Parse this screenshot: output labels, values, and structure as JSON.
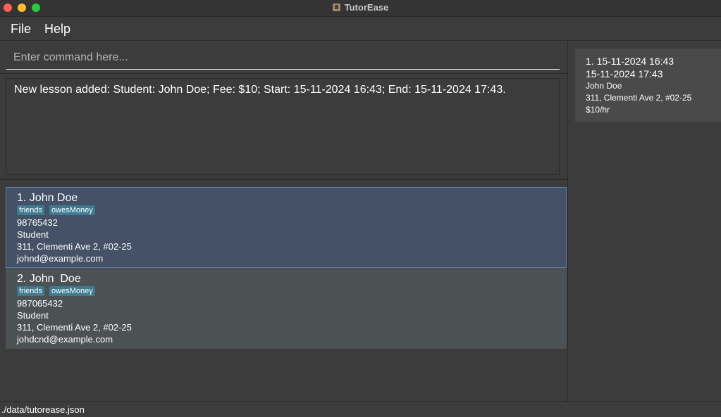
{
  "window": {
    "title": "TutorEase",
    "app_icon": "app-icon"
  },
  "menu": {
    "file": "File",
    "help": "Help"
  },
  "command": {
    "placeholder": "Enter command here...",
    "value": ""
  },
  "result": {
    "text": "New lesson added: Student: John Doe; Fee: $10; Start: 15-11-2024 16:43; End: 15-11-2024 17:43."
  },
  "persons": [
    {
      "name": "1. John Doe",
      "tags": [
        "friends",
        "owesMoney"
      ],
      "phone": "98765432",
      "role": "Student",
      "address": "311, Clementi Ave 2, #02-25",
      "email": "johnd@example.com"
    },
    {
      "name": "2. John  Doe",
      "tags": [
        "friends",
        "owesMoney"
      ],
      "phone": "987065432",
      "role": "Student",
      "address": "311, Clementi Ave 2, #02-25",
      "email": "johdcnd@example.com"
    }
  ],
  "lessons": [
    {
      "start": "1. 15-11-2024 16:43",
      "end": "15-11-2024 17:43",
      "student": "John Doe",
      "address": "311, Clementi Ave 2, #02-25",
      "fee": "$10/hr"
    }
  ],
  "status": {
    "path": "./data/tutorease.json"
  },
  "colors": {
    "background": "#3c3c3c",
    "selected_card": "#445166",
    "card": "#4c5153",
    "tag": "#3e7b91",
    "lesson_card": "#4a4a4a"
  }
}
